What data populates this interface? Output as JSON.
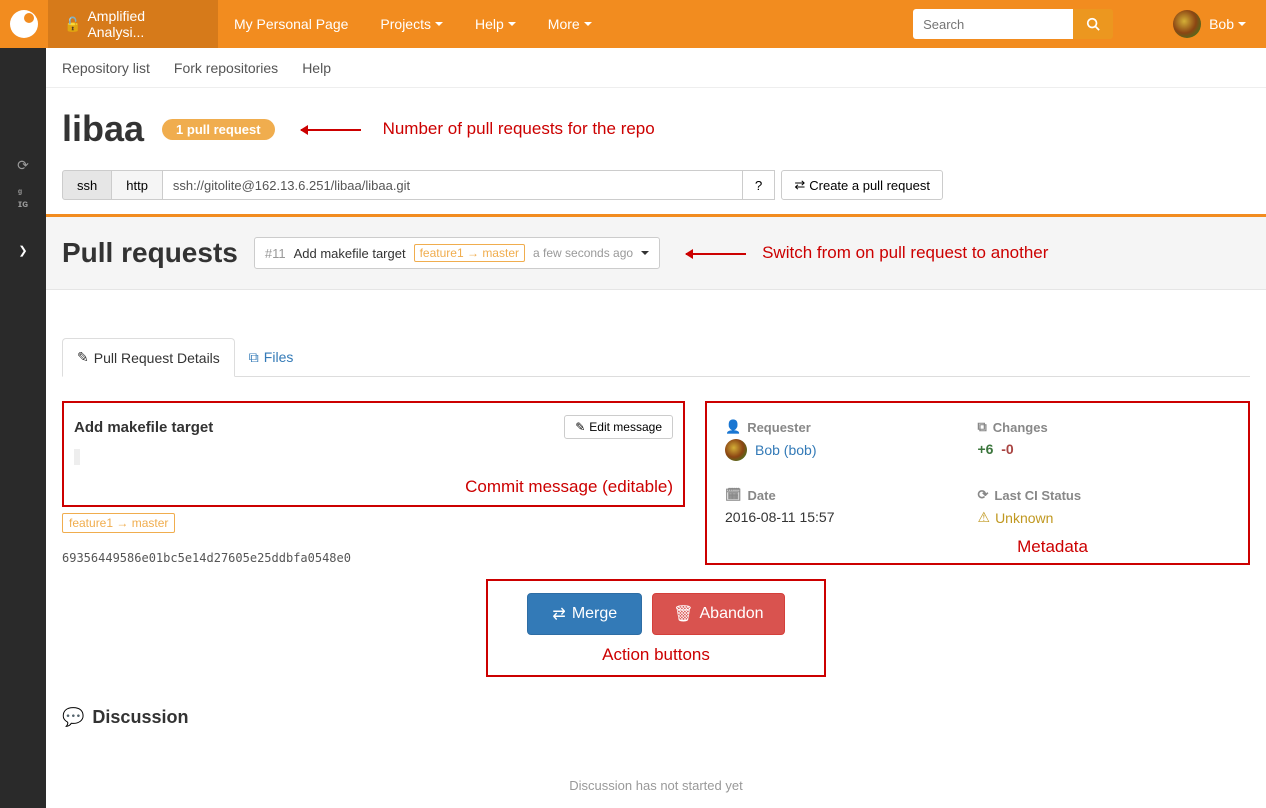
{
  "topnav": {
    "project": "Amplified Analysi...",
    "personal": "My Personal Page",
    "projects": "Projects",
    "help": "Help",
    "more": "More",
    "search_placeholder": "Search",
    "username": "Bob"
  },
  "subnav": {
    "repo_list": "Repository list",
    "fork": "Fork repositories",
    "help": "Help"
  },
  "repo": {
    "name": "libaa",
    "pr_badge": "1 pull request",
    "ssh": "ssh",
    "http": "http",
    "clone_url": "ssh://gitolite@162.13.6.251/libaa/libaa.git",
    "help_q": "?",
    "create_pr": "Create a pull request"
  },
  "pr_list": {
    "heading": "Pull requests",
    "number": "#11",
    "title": "Add makefile target",
    "branch_from": "feature1",
    "branch_to": "master",
    "time": "a few seconds ago"
  },
  "tabs": {
    "details": "Pull Request Details",
    "files": "Files"
  },
  "commit": {
    "title": "Add makefile target",
    "edit": "Edit message",
    "branch_from": "feature1",
    "branch_to": "master",
    "hash": "69356449586e01bc5e14d27605e25ddbfa0548e0"
  },
  "meta": {
    "requester_label": "Requester",
    "requester_name": "Bob (bob)",
    "changes_label": "Changes",
    "additions": "+6",
    "deletions": "-0",
    "date_label": "Date",
    "date_value": "2016-08-11 15:57",
    "ci_label": "Last CI Status",
    "ci_value": "Unknown"
  },
  "actions": {
    "merge": "Merge",
    "abandon": "Abandon"
  },
  "discussion": {
    "heading": "Discussion",
    "empty": "Discussion has not started yet"
  },
  "annotations": {
    "pr_count": "Number of pull requests for the repo",
    "switch": "Switch from on pull request to another",
    "commit_msg": "Commit message (editable)",
    "metadata": "Metadata",
    "action_btns": "Action buttons"
  }
}
